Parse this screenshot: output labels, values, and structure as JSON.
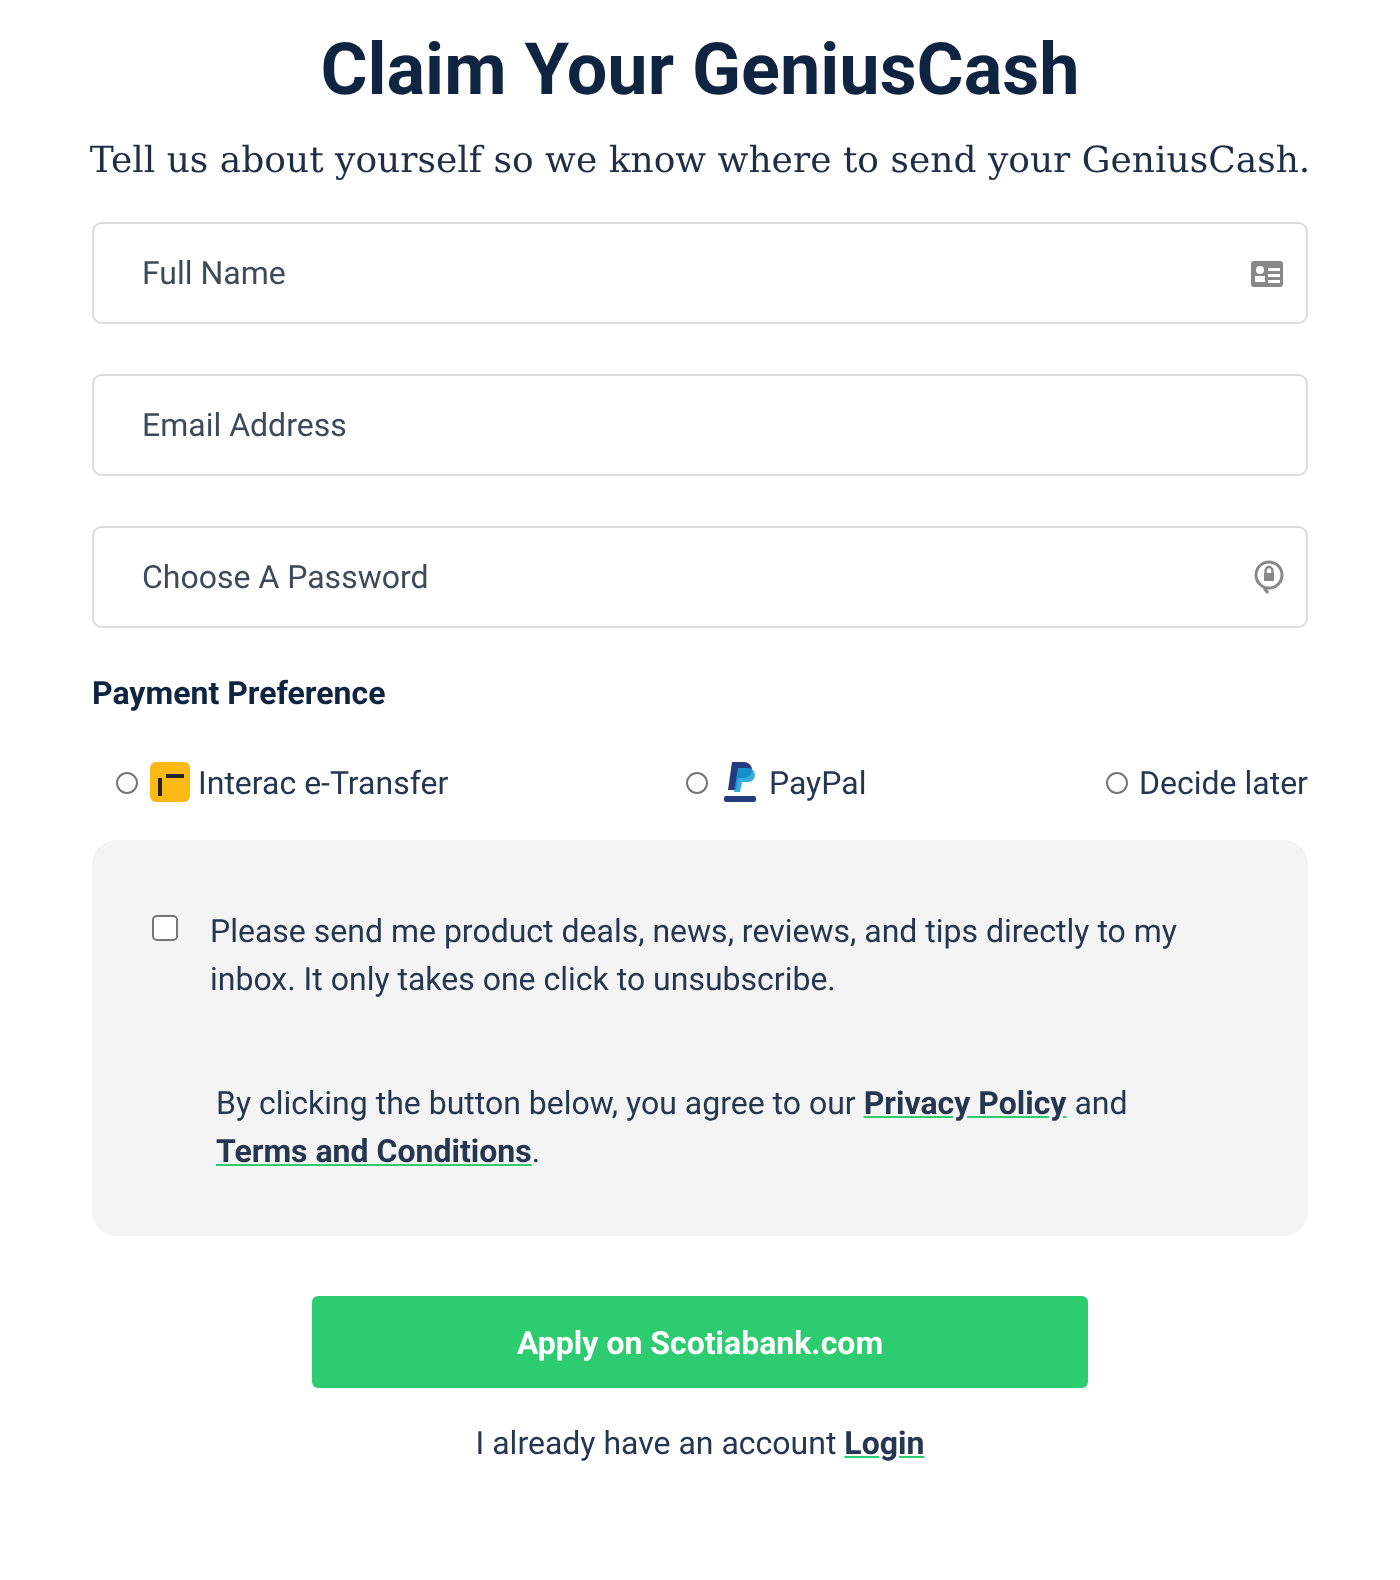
{
  "title": "Claim Your GeniusCash",
  "subtitle": "Tell us about yourself so we know where to send your GeniusCash.",
  "fields": [
    {
      "placeholder": "Full Name",
      "kind": "name"
    },
    {
      "placeholder": "Email Address",
      "kind": "email"
    },
    {
      "placeholder": "Choose A Password",
      "kind": "password"
    }
  ],
  "payment": {
    "label": "Payment Preference",
    "options": [
      {
        "label": "Interac e-Transfer",
        "selected": false,
        "kind": "interac"
      },
      {
        "label": "PayPal",
        "selected": false,
        "kind": "paypal"
      },
      {
        "label": "Decide later",
        "selected": false,
        "kind": "later"
      }
    ]
  },
  "consent": {
    "checked": false,
    "text": "Please send me product deals, news, reviews, and tips directly to my inbox. It only takes one click to unsubscribe."
  },
  "agreement": {
    "before": "By clicking the button below, you agree to our",
    "link1": "Privacy Policy",
    "middle": "and",
    "link2": "Terms and Conditions",
    "after": "."
  },
  "submit": "Apply on Scotiabank.com",
  "login": {
    "text": "I already have an account",
    "link": "Login"
  }
}
